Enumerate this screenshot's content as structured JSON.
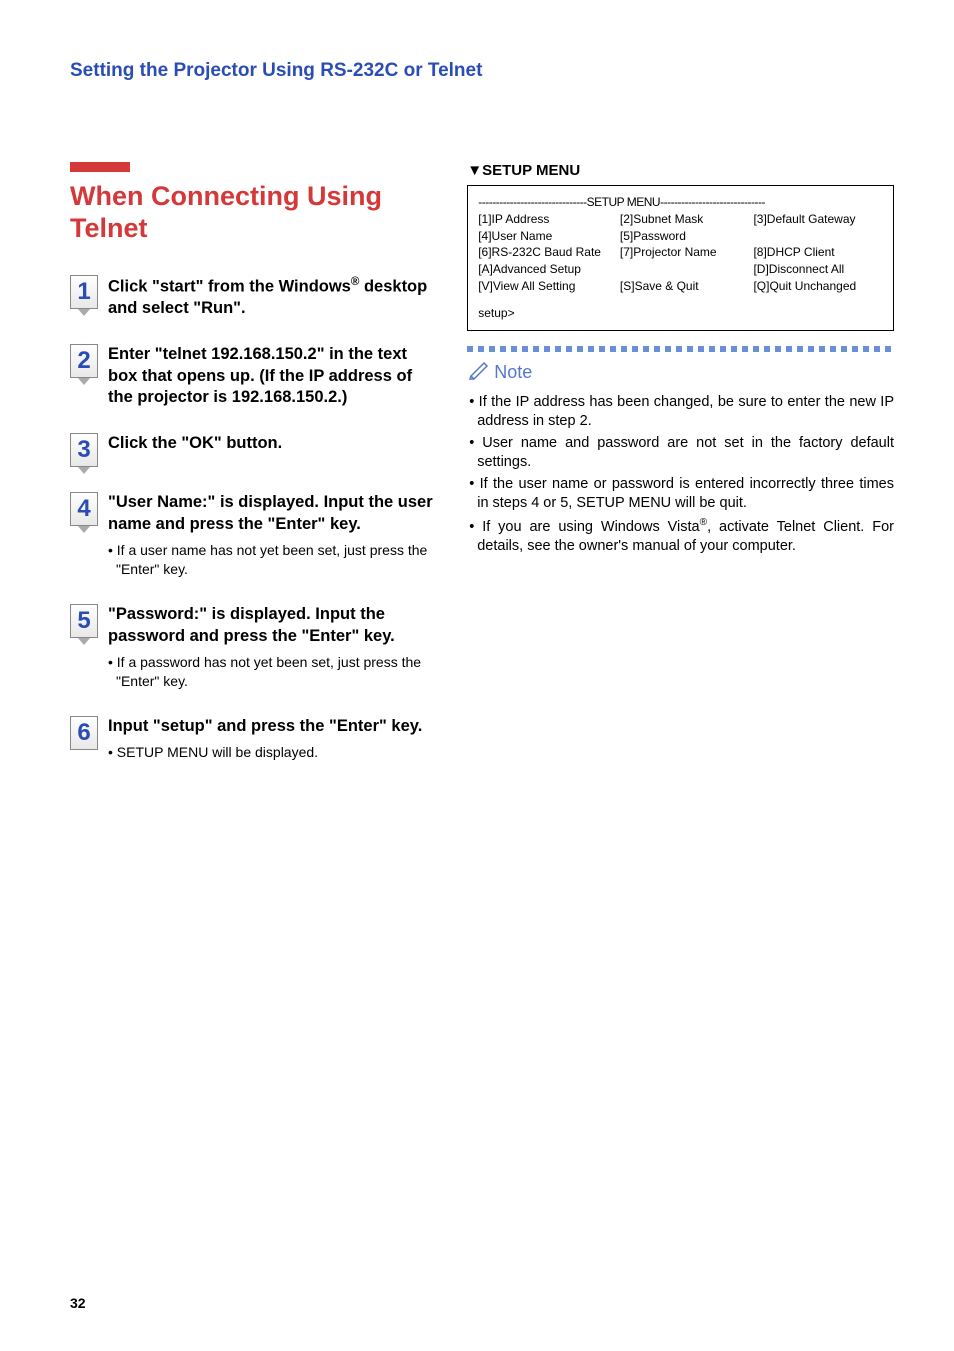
{
  "header": {
    "title": "Setting the Projector Using RS-232C or Telnet"
  },
  "section": {
    "title": "When Connecting Using Telnet"
  },
  "steps": {
    "s1": {
      "num": "1",
      "main_a": "Click \"start\" from the Windows",
      "main_b": " desktop and select \"Run\"."
    },
    "s2": {
      "num": "2",
      "main": "Enter \"telnet 192.168.150.2\" in the text box that opens up. (If the IP address of the projector is 192.168.150.2.)"
    },
    "s3": {
      "num": "3",
      "main": "Click the \"OK\" button."
    },
    "s4": {
      "num": "4",
      "main": "\"User Name:\" is displayed. Input the user name and press the \"Enter\" key.",
      "sub": "• If a user name has not yet been set, just press the \"Enter\" key."
    },
    "s5": {
      "num": "5",
      "main": "\"Password:\" is displayed. Input the password and press the \"Enter\" key.",
      "sub": "• If a password has not yet been set, just press the \"Enter\" key."
    },
    "s6": {
      "num": "6",
      "main": "Input \"setup\" and press the \"Enter\" key.",
      "sub": "• SETUP MENU will be displayed."
    }
  },
  "setup_menu": {
    "label": "SETUP MENU",
    "dashes_left": "-------------------------------",
    "dashes_right": "------------------------------",
    "r1c1": "[1]IP Address",
    "r1c2": "[2]Subnet Mask",
    "r1c3": "[3]Default Gateway",
    "r2c1": "[4]User Name",
    "r2c2": "[5]Password",
    "r3c1": "[6]RS-232C Baud Rate",
    "r3c2": "[7]Projector Name",
    "r3c3": "[8]DHCP Client",
    "r4c1": "[A]Advanced Setup",
    "r4c3": "[D]Disconnect All",
    "r5c1": "[V]View All Setting",
    "r5c2": "[S]Save & Quit",
    "r5c3": "[Q]Quit Unchanged",
    "prompt": "setup>"
  },
  "note": {
    "label": "Note",
    "n1": "• If the IP address has been changed, be sure to enter the new IP address in step 2.",
    "n2": "• User name and password are not set in the factory default settings.",
    "n3": "• If the user name or password is entered incorrectly three times in steps 4 or 5, SETUP MENU will be quit.",
    "n4a": "• If you are using Windows Vista",
    "n4b": ", activate Telnet Client. For details, see the owner's manual of your computer."
  },
  "page_number": "32"
}
